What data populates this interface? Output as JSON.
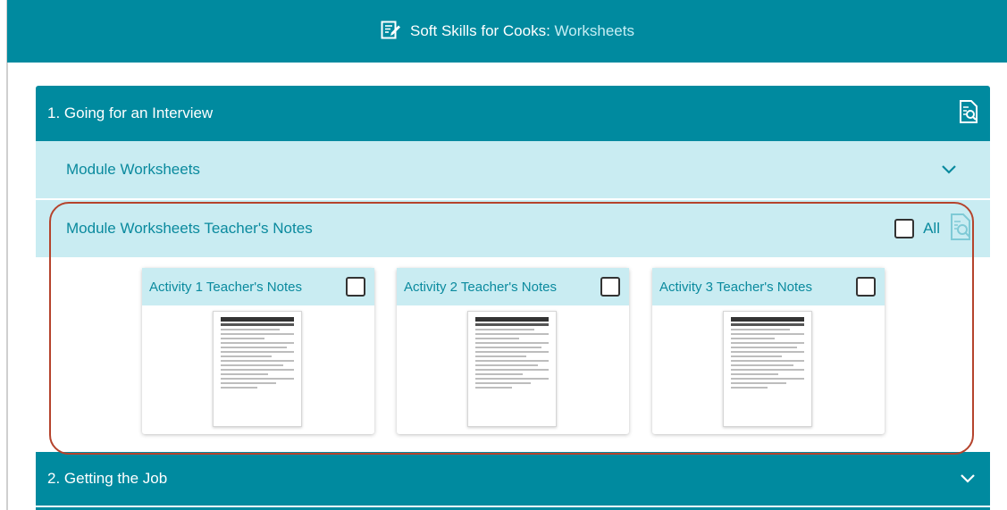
{
  "app": {
    "title_main": "Soft Skills for Cooks:",
    "title_sub": "Worksheets",
    "title_icon": "edit-document-icon"
  },
  "sections": [
    {
      "label": "1. Going for an Interview",
      "icon": "document-search-icon",
      "subsections": [
        {
          "label": "Module Worksheets",
          "icon": "chevron-down-icon"
        },
        {
          "label": "Module Worksheets Teacher's Notes",
          "all_label": "All",
          "icon": "document-search-icon",
          "cards": [
            {
              "label": "Activity 1 Teacher's Notes"
            },
            {
              "label": "Activity 2 Teacher's Notes"
            },
            {
              "label": "Activity 3 Teacher's Notes"
            }
          ]
        }
      ]
    },
    {
      "label": "2. Getting the Job",
      "icon": "chevron-down-icon"
    }
  ],
  "colors": {
    "header_teal": "#008a9f",
    "subheader_light": "#c9ecf2",
    "highlight_border": "#b5432c"
  }
}
